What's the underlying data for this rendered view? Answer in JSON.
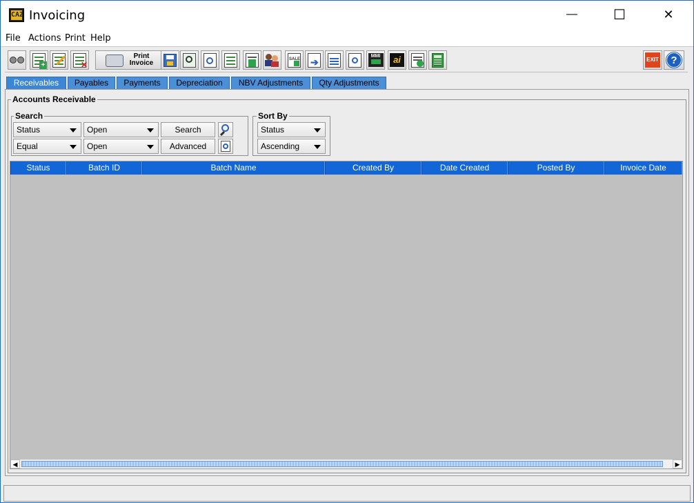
{
  "window": {
    "title": "Invoicing",
    "app_icon_text": "CAZ",
    "minimize_glyph": "—",
    "maximize_glyph": "☐",
    "close_glyph": "✕"
  },
  "menubar": {
    "items": [
      "File",
      "Actions",
      "Print",
      "Help"
    ]
  },
  "toolbar": {
    "print_invoice_label": "Print\nInvoice",
    "exit_label": "EXIT",
    "help_label": "?",
    "buttons": [
      "binoculars-icon",
      "add-icon",
      "edit-icon",
      "delete-icon",
      "save-icon",
      "magnify-icon",
      "document-search-icon",
      "document-list-icon",
      "invoice-icon",
      "users-icon",
      "sale-icon",
      "forward-arrow-icon",
      "page-icon",
      "page-search-icon",
      "mmi-icon",
      "ai-icon",
      "report-icon",
      "calculator-icon"
    ]
  },
  "tabs": [
    "Receivables",
    "Payables",
    "Payments",
    "Depreciation",
    "NBV Adjustments",
    "Qty Adjustments"
  ],
  "active_tab": "Receivables",
  "panel": {
    "title": "Accounts Receivable",
    "search": {
      "title": "Search",
      "field1": "Status",
      "value1": "Open",
      "operator": "Equal",
      "value2": "Open",
      "search_button": "Search",
      "advanced_button": "Advanced"
    },
    "sort": {
      "title": "Sort By",
      "field": "Status",
      "order": "Ascending"
    }
  },
  "table": {
    "columns": [
      "Status",
      "Batch ID",
      "Batch Name",
      "Created By",
      "Date Created",
      "Posted By",
      "Invoice Date"
    ],
    "rows": []
  },
  "scrollbar": {
    "left_arrow": "◀",
    "right_arrow": "▶"
  },
  "colors": {
    "header_blue": "#1266d8",
    "tab_blue": "#4a8fd8",
    "panel_gray": "#ececec",
    "table_bg": "#c0c0c0"
  }
}
